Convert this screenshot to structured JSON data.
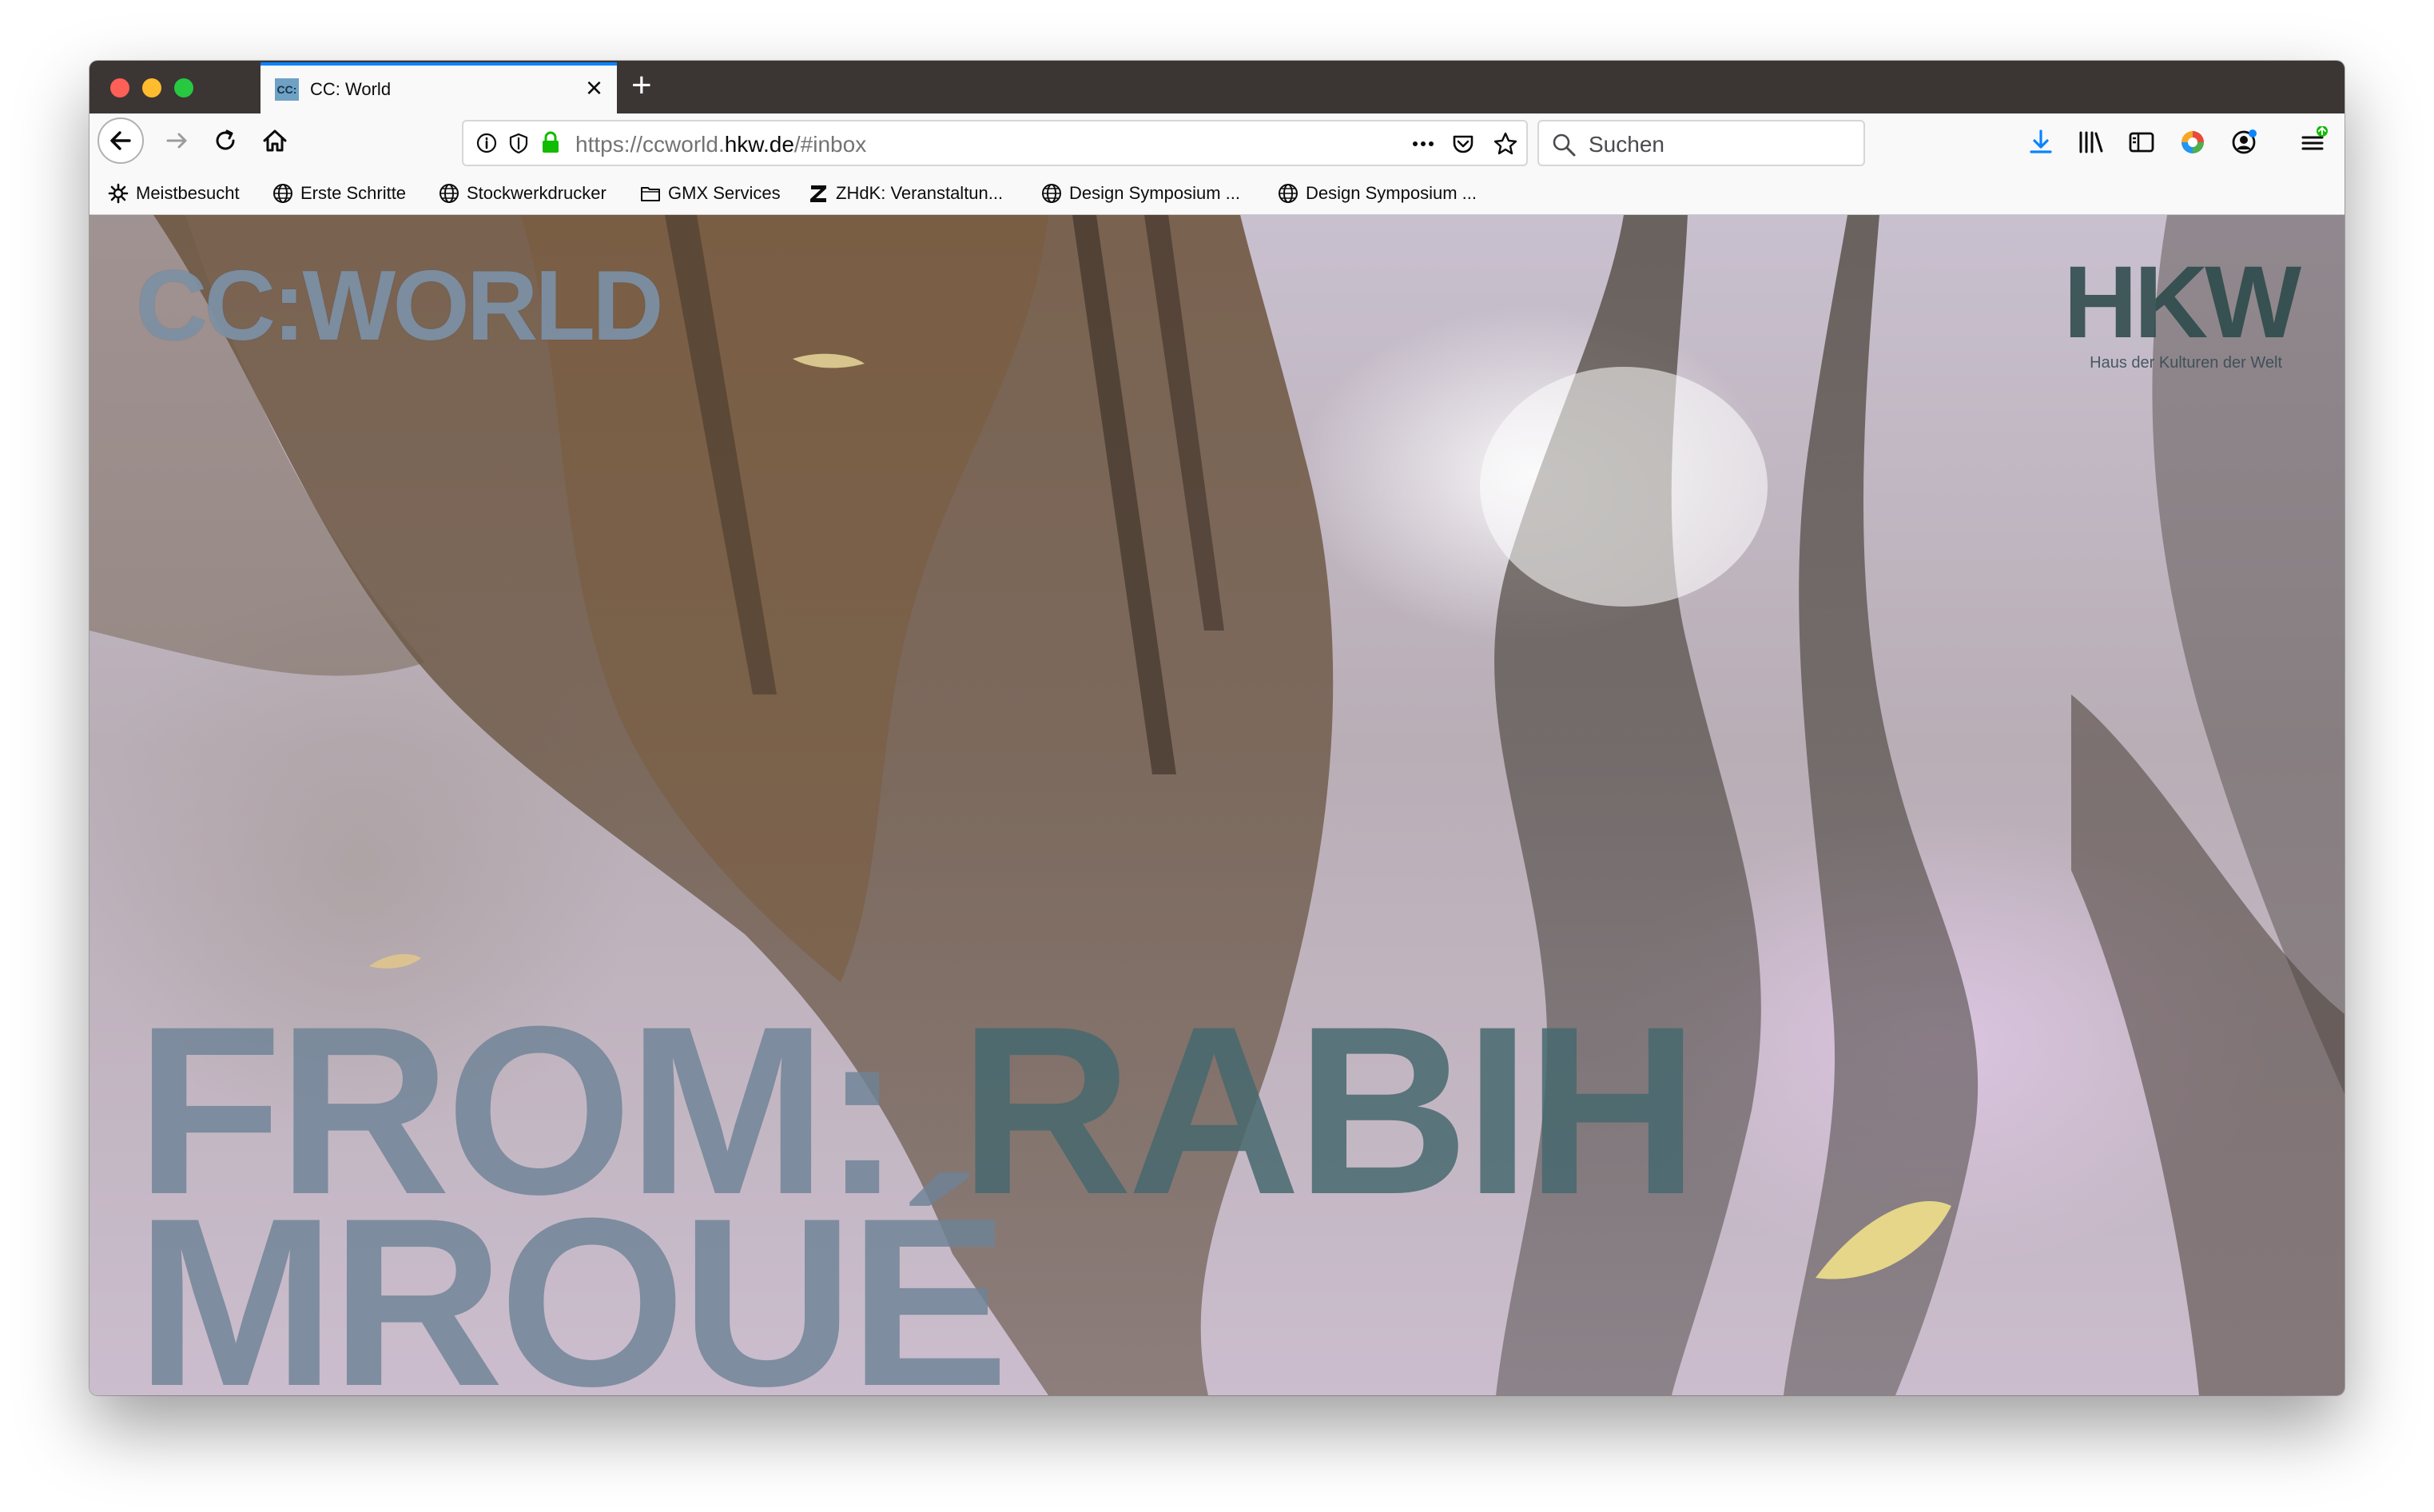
{
  "tab": {
    "favicon_text": "CC:",
    "title": "CC: World"
  },
  "urlbar": {
    "url_prefix": "https://ccworld.",
    "url_domain": "hkw.de",
    "url_suffix": "/#inbox"
  },
  "search": {
    "placeholder": "Suchen"
  },
  "bookmarks": [
    {
      "label": "Meistbesucht"
    },
    {
      "label": "Erste Schritte"
    },
    {
      "label": "Stockwerkdrucker"
    },
    {
      "label": "GMX Services"
    },
    {
      "label": "ZHdK: Veranstaltun..."
    },
    {
      "label": "Design Symposium ..."
    },
    {
      "label": "Design Symposium ..."
    }
  ],
  "page": {
    "logo": "CC:WORLD",
    "partner_logo": "HKW",
    "partner_subtitle": "Haus der Kulturen der Welt",
    "hero_prefix": "FROM:",
    "hero_first_name": "RABIH",
    "hero_last_name": "MROUÉ"
  },
  "colors": {
    "tab_accent": "#0a84ff",
    "secure_lock": "#12bc00",
    "download": "#0a84ff"
  }
}
